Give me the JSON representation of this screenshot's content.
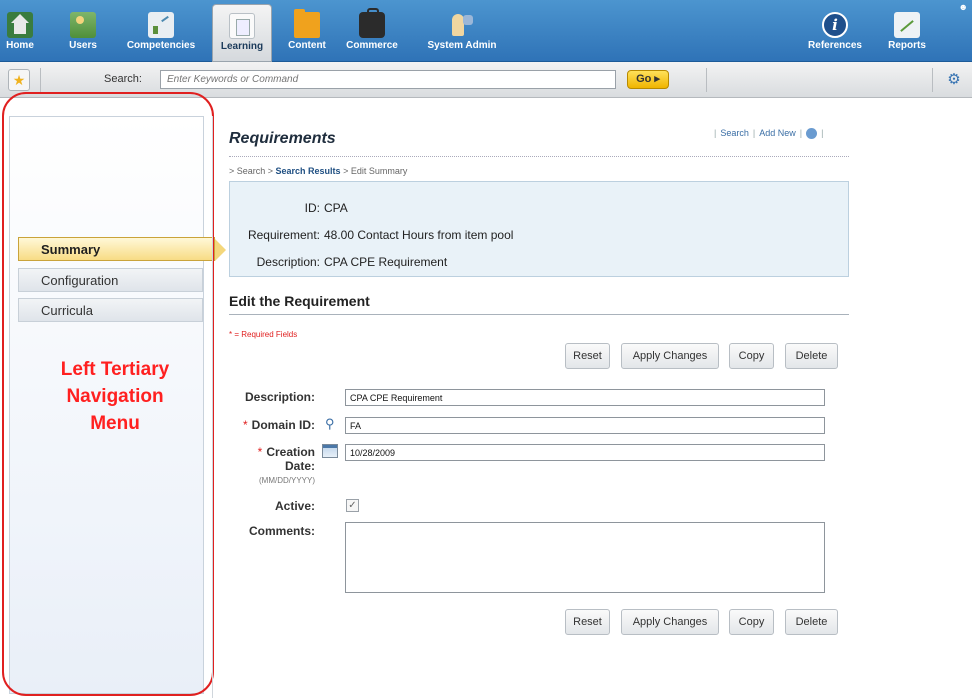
{
  "topnav": {
    "items": [
      {
        "label": "Home",
        "icon": "home-icon"
      },
      {
        "label": "Users",
        "icon": "users-icon"
      },
      {
        "label": "Competencies",
        "icon": "competencies-icon"
      },
      {
        "label": "Learning",
        "icon": "learning-icon",
        "active": true
      },
      {
        "label": "Content",
        "icon": "content-folder-icon"
      },
      {
        "label": "Commerce",
        "icon": "commerce-briefcase-icon"
      },
      {
        "label": "System Admin",
        "icon": "system-admin-icon"
      },
      {
        "label": "References",
        "icon": "info-icon"
      },
      {
        "label": "Reports",
        "icon": "reports-icon"
      }
    ]
  },
  "searchbar": {
    "label": "Search:",
    "placeholder": "Enter Keywords or Command",
    "go_label": "Go ▸"
  },
  "leftnav": {
    "items": [
      {
        "label": "Summary",
        "active": true
      },
      {
        "label": "Configuration"
      },
      {
        "label": "Curricula"
      }
    ],
    "annotation": "Left Tertiary\nNavigation\nMenu"
  },
  "page": {
    "title": "Requirements",
    "links": {
      "search": "Search",
      "add_new": "Add New"
    },
    "breadcrumb": {
      "prefix": "> Search > ",
      "results": "Search Results",
      "suffix": " > Edit Summary"
    }
  },
  "summary": {
    "id_label": "ID:",
    "id_value": "CPA",
    "requirement_label": "Requirement:",
    "requirement_value": "48.00 Contact Hours from item pool",
    "description_label": "Description:",
    "description_value": "CPA CPE Requirement"
  },
  "edit": {
    "heading": "Edit the Requirement",
    "required_note": "* = Required Fields",
    "buttons": {
      "reset": "Reset",
      "apply": "Apply Changes",
      "copy": "Copy",
      "delete": "Delete"
    },
    "fields": {
      "description_label": "Description:",
      "description_value": "CPA CPE Requirement",
      "domain_label": "Domain ID:",
      "domain_value": "FA",
      "creation_label": "Creation",
      "creation_label2": "Date:",
      "creation_format": "(MM/DD/YYYY)",
      "creation_value": "10/28/2009",
      "active_label": "Active:",
      "active_checked": true,
      "comments_label": "Comments:",
      "comments_value": ""
    }
  }
}
